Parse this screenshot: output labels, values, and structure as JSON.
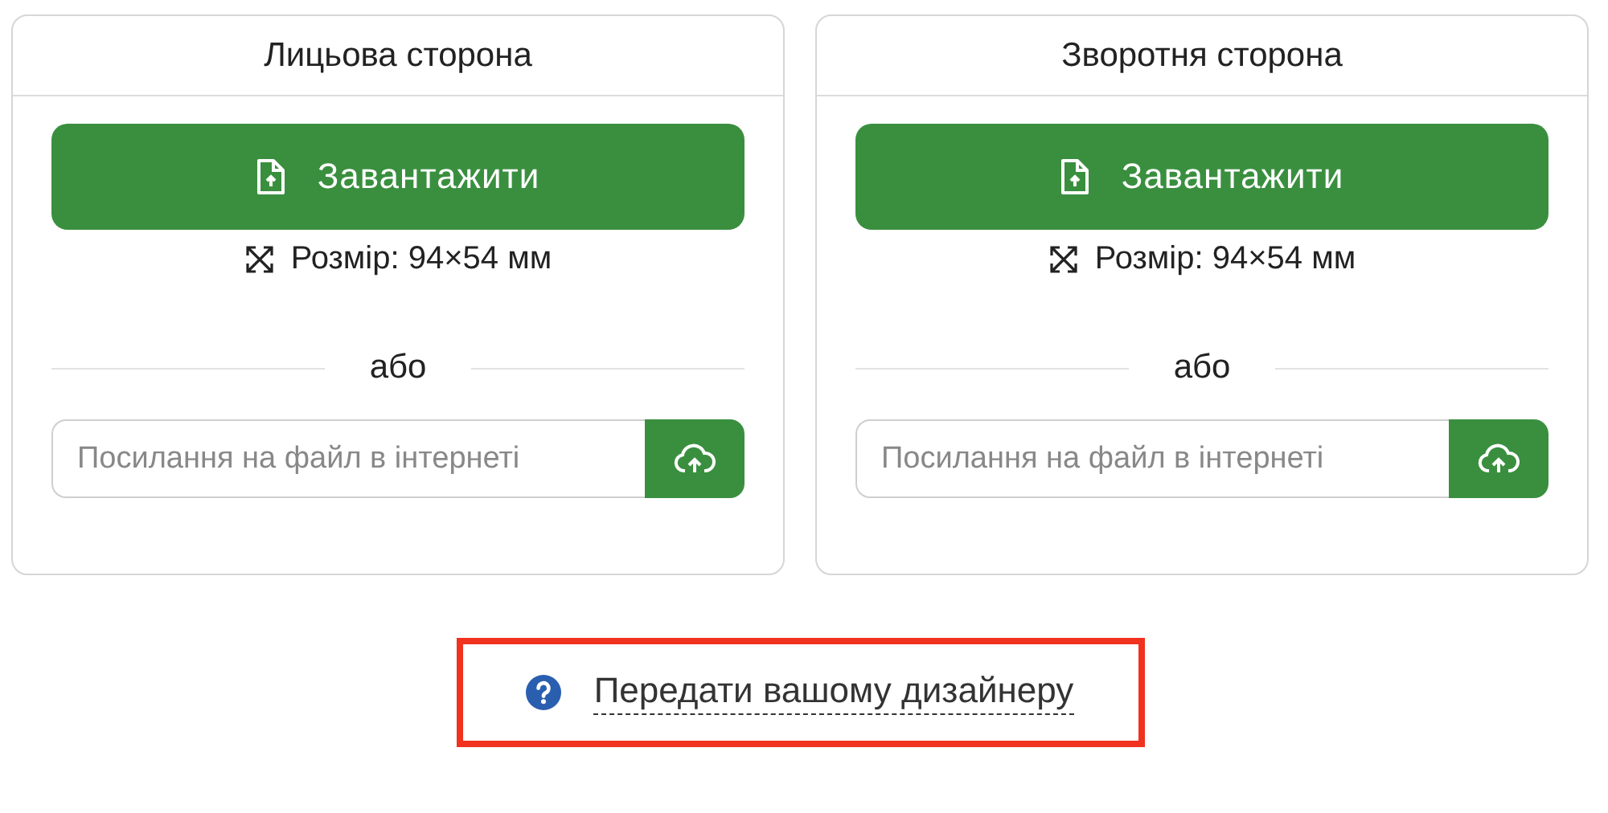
{
  "sides": [
    {
      "title": "Лицьова сторона",
      "upload_button": "Завантажити",
      "size": "Розмір: 94×54 мм",
      "divider": "або",
      "url_field": {
        "placeholder": "Посилання на файл в інтернеті"
      }
    },
    {
      "title": "Зворотня сторона",
      "upload_button": "Завантажити",
      "size": "Розмір: 94×54 мм",
      "divider": "або",
      "url_field": {
        "placeholder": "Посилання на файл в інтернеті"
      }
    }
  ],
  "designer_link": {
    "label": "Передати вашому дизайнеру",
    "highlighted": true
  }
}
